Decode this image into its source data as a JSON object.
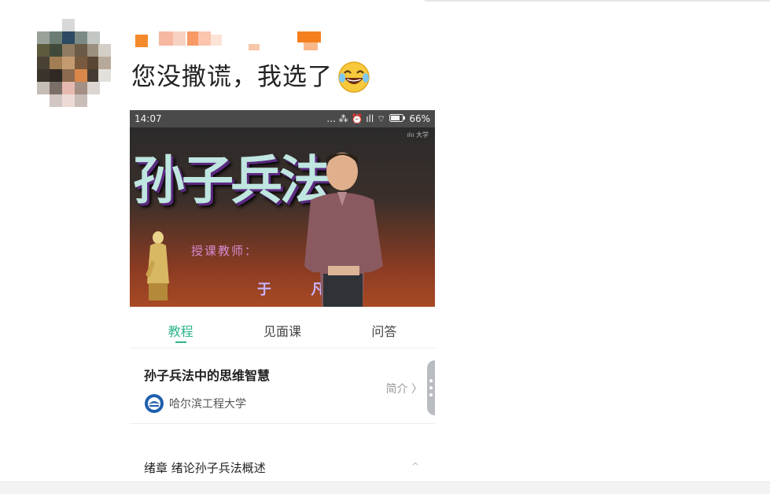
{
  "post": {
    "text": "您没撒谎，我选了",
    "emoji_icon": "laughing-tears-emoji"
  },
  "screenshot": {
    "statusbar": {
      "time": "14:07",
      "icons": "... ⁂ ⏰ ıll ⌔",
      "battery": "66%"
    },
    "video": {
      "title": "孙子兵法",
      "teacher_label": "授课教师：",
      "teacher_name": "于 凡",
      "watermark": "ılıı 大学"
    },
    "tabs": [
      {
        "label": "教程",
        "active": true
      },
      {
        "label": "见面课",
        "active": false
      },
      {
        "label": "问答",
        "active": false
      }
    ],
    "course": {
      "title": "孙子兵法中的思维智慧",
      "organization": "哈尔滨工程大学",
      "intro_link": "简介 〉"
    },
    "chapter": {
      "label": "绪章 绪论孙子兵法概述",
      "caret": "^"
    }
  },
  "colors": {
    "accent_green": "#2fb48b",
    "statusbar_bg": "#4a4a4a"
  }
}
